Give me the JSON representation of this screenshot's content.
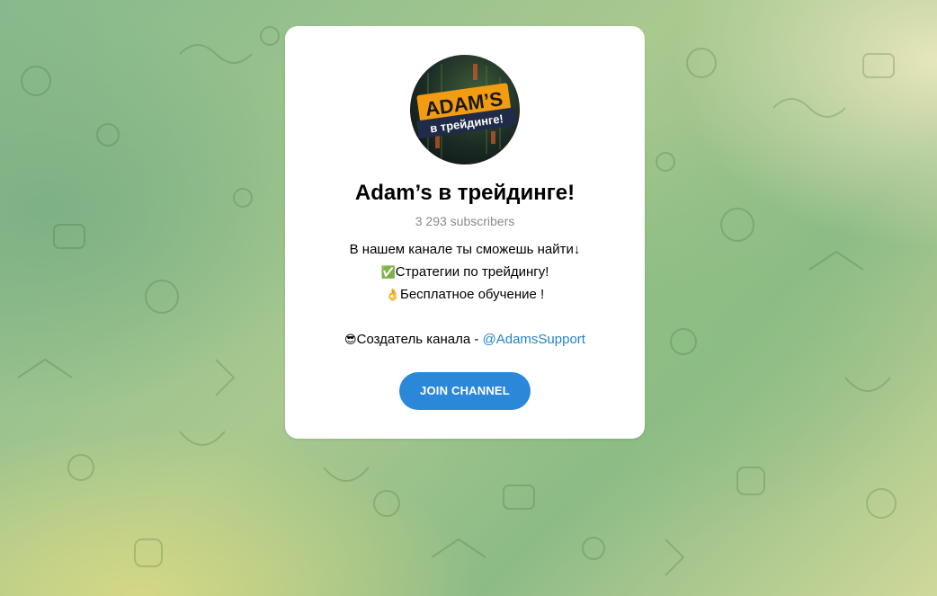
{
  "channel": {
    "title": "Adam’s в трейдинге!",
    "subscribers": "3 293 subscribers",
    "avatar": {
      "text_line1": "ADAM’S",
      "text_line2": "в трейдинге!"
    },
    "description": {
      "line1_icon": "",
      "line1_text": "В нашем канале ты сможешь найти↓",
      "line2_icon": "✅",
      "line2_text": "Стратегии по трейдингу!",
      "line3_icon": "👌",
      "line3_text": "Бесплатное обучение !",
      "line5_icon": "😎",
      "line5_text": "Создатель канала - ",
      "line5_link": "@AdamsSupport"
    },
    "join_label": "JOIN CHANNEL"
  },
  "colors": {
    "accent": "#2b88d9",
    "link": "#2481cc",
    "muted": "#8a8a8a",
    "avatar_badge": "#f39c12"
  }
}
